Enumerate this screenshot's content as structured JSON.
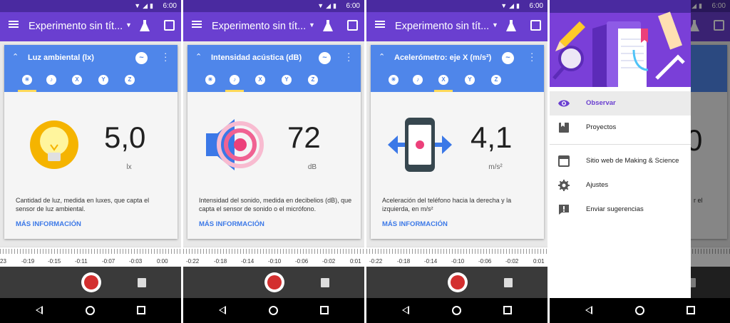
{
  "status": {
    "time": "6:00"
  },
  "app": {
    "title": "Experimento sin tít..."
  },
  "panels": [
    {
      "card_title": "Luz ambiental (lx)",
      "active_tab": 0,
      "value": "5,0",
      "unit": "lx",
      "description": "Cantidad de luz, medida en luxes, que capta el sensor de luz ambiental.",
      "more": "MÁS INFORMACIÓN",
      "axis": [
        "23",
        "-0:19",
        "-0:15",
        "-0:11",
        "-0:07",
        "-0:03",
        "0:00"
      ]
    },
    {
      "card_title": "Intensidad acústica (dB)",
      "active_tab": 1,
      "value": "72",
      "unit": "dB",
      "description": "Intensidad del sonido, medida en decibelios (dB), que capta el sensor de sonido o el micrófono.",
      "more": "MÁS INFORMACIÓN",
      "axis": [
        "-0:22",
        "-0:18",
        "-0:14",
        "-0:10",
        "-0:06",
        "-0:02",
        "0:01"
      ]
    },
    {
      "card_title": "Acelerómetro: eje X (m/s²)",
      "active_tab": 2,
      "value": "4,1",
      "unit": "m/s²",
      "description": "Aceleración del teléfono hacia la derecha y la izquierda, en m/s²",
      "more": "MÁS INFORMACIÓN",
      "axis": [
        "-0:22",
        "-0:18",
        "-0:14",
        "-0:10",
        "-0:06",
        "-0:02",
        "0:01"
      ]
    }
  ],
  "tabs": [
    "light",
    "sound",
    "X",
    "Y",
    "Z"
  ],
  "drawer": {
    "items": [
      {
        "label": "Observar",
        "icon": "eye-icon"
      },
      {
        "label": "Proyectos",
        "icon": "bookmark-icon"
      },
      {
        "label": "Sitio web de Making & Science",
        "icon": "browser-icon"
      },
      {
        "label": "Ajustes",
        "icon": "gear-icon"
      },
      {
        "label": "Enviar sugerencias",
        "icon": "feedback-icon"
      }
    ],
    "bg_value": "0",
    "bg_text": "r el"
  },
  "colors": {
    "primary": "#6a3fd0",
    "status": "#4a2aa0",
    "card": "#4f86ea",
    "record": "#d32f2f"
  }
}
